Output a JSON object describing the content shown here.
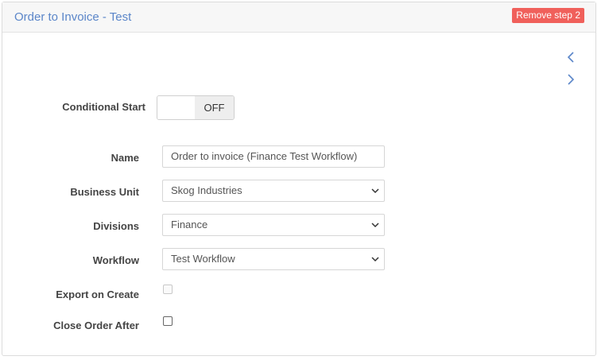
{
  "header": {
    "title": "Order to Invoice - Test",
    "remove_button": "Remove step 2"
  },
  "nav": {
    "prev_icon": "chevron-left-icon",
    "next_icon": "chevron-right-icon"
  },
  "form": {
    "conditional_start": {
      "label": "Conditional Start",
      "state": "OFF"
    },
    "name": {
      "label": "Name",
      "value": "Order to invoice (Finance Test Workflow)"
    },
    "business_unit": {
      "label": "Business Unit",
      "value": "Skog Industries"
    },
    "divisions": {
      "label": "Divisions",
      "value": "Finance"
    },
    "workflow": {
      "label": "Workflow",
      "value": "Test Workflow"
    },
    "export_on_create": {
      "label": "Export on Create",
      "checked": false,
      "disabled": true
    },
    "close_order_after": {
      "label": "Close Order After",
      "checked": false
    }
  },
  "colors": {
    "title": "#5b86c9",
    "remove_button": "#f0605b",
    "arrows": "#5b86c9"
  }
}
